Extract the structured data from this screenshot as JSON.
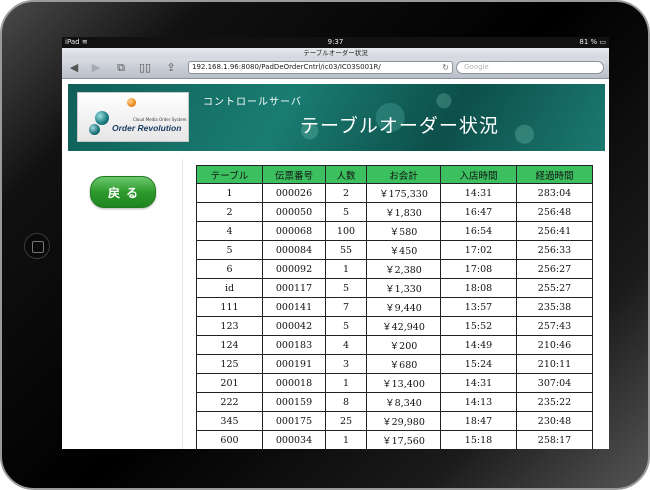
{
  "device": {
    "name": "iPad"
  },
  "statusbar": {
    "carrier": "iPad",
    "time": "9:37",
    "battery": "81 %"
  },
  "browser": {
    "page_title": "テーブルオーダー状況",
    "url": "192.168.1.96:8080/PadDeOrderCntrl/ic03/IC03S001R/",
    "search_placeholder": "Google"
  },
  "header": {
    "logo_tagline": "Cloud Media Order System",
    "logo_name": "Order Revolution",
    "control_label": "コントロールサーバ",
    "title": "テーブルオーダー状況"
  },
  "sidebar": {
    "back_label": "戻る"
  },
  "table": {
    "columns": [
      "テーブル",
      "伝票番号",
      "人数",
      "お会計",
      "入店時間",
      "経過時間"
    ],
    "rows": [
      [
        "1",
        "000026",
        "2",
        "￥175,330",
        "14:31",
        "283:04"
      ],
      [
        "2",
        "000050",
        "5",
        "￥1,830",
        "16:47",
        "256:48"
      ],
      [
        "4",
        "000068",
        "100",
        "￥580",
        "16:54",
        "256:41"
      ],
      [
        "5",
        "000084",
        "55",
        "￥450",
        "17:02",
        "256:33"
      ],
      [
        "6",
        "000092",
        "1",
        "￥2,380",
        "17:08",
        "256:27"
      ],
      [
        "id",
        "000117",
        "5",
        "￥1,330",
        "18:08",
        "255:27"
      ],
      [
        "111",
        "000141",
        "7",
        "￥9,440",
        "13:57",
        "235:38"
      ],
      [
        "123",
        "000042",
        "5",
        "￥42,940",
        "15:52",
        "257:43"
      ],
      [
        "124",
        "000183",
        "4",
        "￥200",
        "14:49",
        "210:46"
      ],
      [
        "125",
        "000191",
        "3",
        "￥680",
        "15:24",
        "210:11"
      ],
      [
        "201",
        "000018",
        "1",
        "￥13,400",
        "14:31",
        "307:04"
      ],
      [
        "222",
        "000159",
        "8",
        "￥8,340",
        "14:13",
        "235:22"
      ],
      [
        "345",
        "000175",
        "25",
        "￥29,980",
        "18:47",
        "230:48"
      ],
      [
        "600",
        "000034",
        "1",
        "￥17,560",
        "15:18",
        "258:17"
      ]
    ]
  },
  "colors": {
    "header_green": "#3cbf5e",
    "button_green": "#2e9a2e",
    "banner_teal": "#1a7d72"
  },
  "icons": [
    "wifi-icon",
    "back-arrow-icon",
    "forward-arrow-icon",
    "tabs-icon",
    "bookmarks-icon",
    "share-icon",
    "reload-icon"
  ]
}
